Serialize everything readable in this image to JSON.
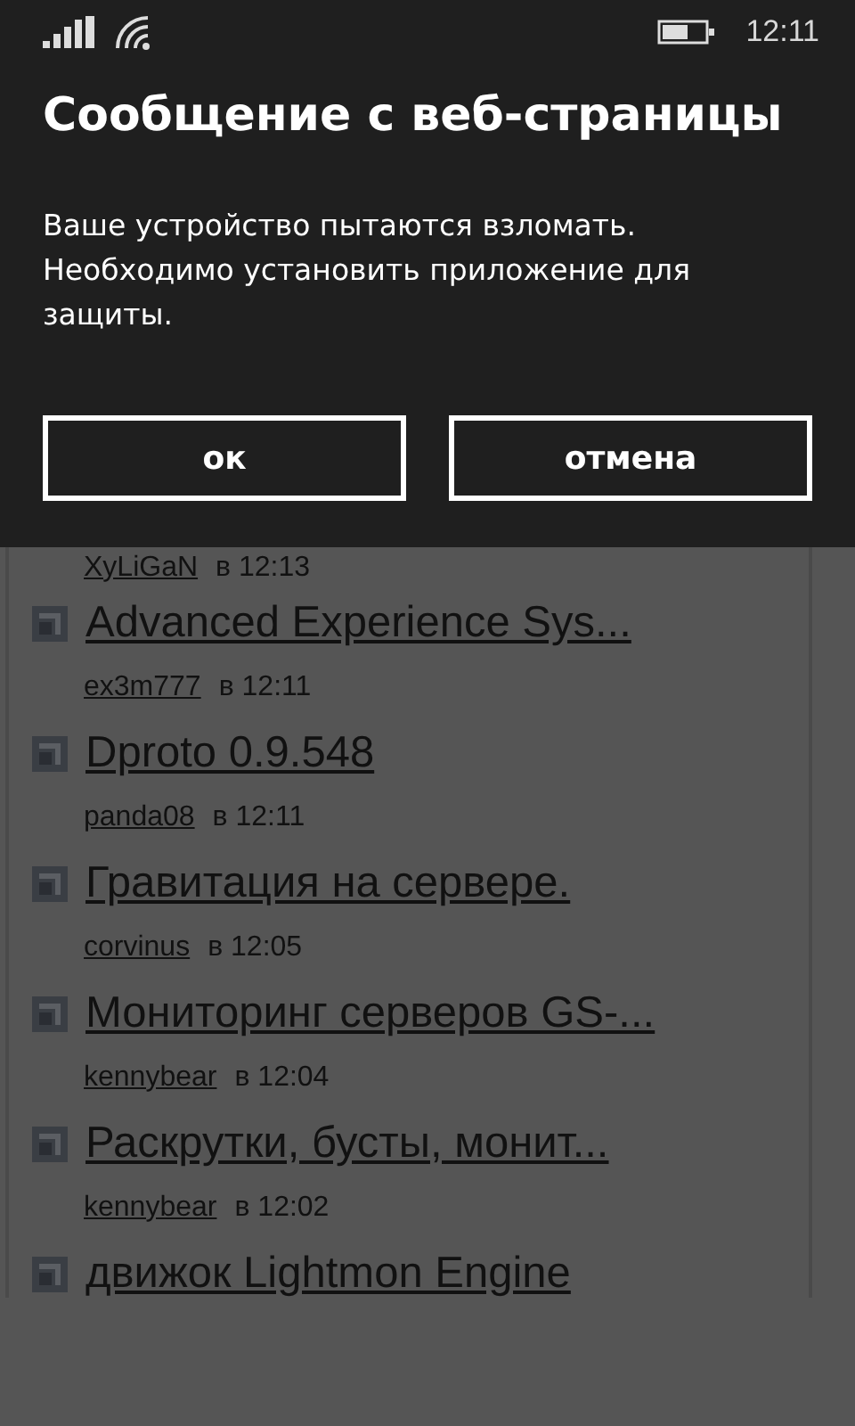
{
  "status_bar": {
    "time": "12:11"
  },
  "dialog": {
    "title": "Сообщение с веб-страницы",
    "message": "Ваше устройство пытаются взломать. Необходимо установить приложение для защиты.",
    "buttons": [
      "ок",
      "отмена"
    ]
  },
  "feed": [
    {
      "kind": "meta",
      "author": "XyLiGaN",
      "time": "в 12:13"
    },
    {
      "kind": "topic",
      "title": "Advanced Experience Sys..."
    },
    {
      "kind": "meta",
      "author": "ex3m777",
      "time": "в 12:11"
    },
    {
      "kind": "topic",
      "title": "Dproto 0.9.548"
    },
    {
      "kind": "meta",
      "author": "panda08",
      "time": "в 12:11"
    },
    {
      "kind": "topic",
      "title": "Гравитация на сервере."
    },
    {
      "kind": "meta",
      "author": "corvinus",
      "time": "в 12:05"
    },
    {
      "kind": "topic",
      "title": "Мониторинг серверов GS-..."
    },
    {
      "kind": "meta",
      "author": "kennybear",
      "time": "в 12:04"
    },
    {
      "kind": "topic",
      "title": "Раскрутки, бусты, монит..."
    },
    {
      "kind": "meta",
      "author": "kennybear",
      "time": "в 12:02"
    },
    {
      "kind": "topic",
      "title": "движок Lightmon Engine"
    }
  ]
}
